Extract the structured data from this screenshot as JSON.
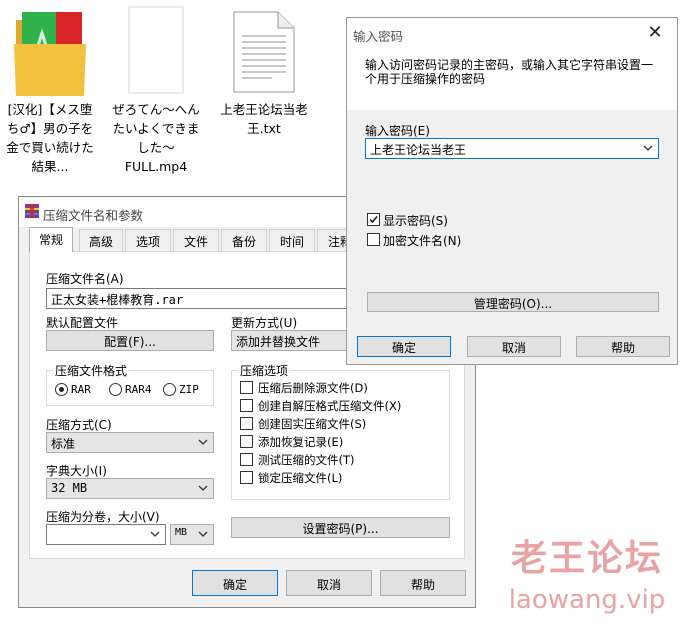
{
  "desktop": {
    "files": [
      {
        "label_lines": [
          "[汉化]【メス堕",
          "ち♂】男の子を",
          "金で買い続けた",
          "結果..."
        ]
      },
      {
        "label_lines": [
          "ぜろてん～へん",
          "たいよくできま",
          "した～",
          "FULL.mp4"
        ]
      },
      {
        "label_lines": [
          "上老王论坛当老",
          "王.txt"
        ]
      }
    ]
  },
  "archive_dialog": {
    "title": "压缩文件名和参数",
    "tabs": [
      "常规",
      "高级",
      "选项",
      "文件",
      "备份",
      "时间",
      "注释"
    ],
    "active_tab": "常规",
    "archive_name_label": "压缩文件名(A)",
    "archive_name_value": "正太女装+棍棒教育.rar",
    "default_profile_label": "默认配置文件",
    "profile_button": "配置(F)...",
    "update_mode_label": "更新方式(U)",
    "update_mode_value": "添加并替换文件",
    "format_group_title": "压缩文件格式",
    "formats": [
      "RAR",
      "RAR4",
      "ZIP"
    ],
    "selected_format": "RAR",
    "options_group_title": "压缩选项",
    "options": [
      {
        "label": "压缩后删除源文件(D)",
        "checked": false
      },
      {
        "label": "创建自解压格式压缩文件(X)",
        "checked": false
      },
      {
        "label": "创建固实压缩文件(S)",
        "checked": false
      },
      {
        "label": "添加恢复记录(E)",
        "checked": false
      },
      {
        "label": "测试压缩的文件(T)",
        "checked": false
      },
      {
        "label": "锁定压缩文件(L)",
        "checked": false
      }
    ],
    "method_label": "压缩方式(C)",
    "method_value": "标准",
    "dict_label": "字典大小(I)",
    "dict_value": "32 MB",
    "split_label": "压缩为分卷，大小(V)",
    "split_value": "",
    "split_unit": "MB",
    "set_password_button": "设置密码(P)...",
    "ok_button": "确定",
    "cancel_button": "取消",
    "help_button": "帮助"
  },
  "password_dialog": {
    "title": "输入密码",
    "description": "输入访问密码记录的主密码，或输入其它字符串设置一个用于压缩操作的密码",
    "password_label": "输入密码(E)",
    "password_value": "上老王论坛当老王",
    "show_password_label": "显示密码(S)",
    "show_password_checked": true,
    "encrypt_names_label": "加密文件名(N)",
    "encrypt_names_checked": false,
    "manage_button": "管理密码(O)...",
    "ok_button": "确定",
    "cancel_button": "取消",
    "help_button": "帮助"
  },
  "watermark": {
    "title": "老王论坛",
    "url": "laowang.vip"
  },
  "colors": {
    "folder": "#f3c23d",
    "cover_green": "#2fb24a",
    "cover_red": "#d9252a",
    "focus_blue": "#0078d7",
    "watermark": "#e8a4a4"
  }
}
